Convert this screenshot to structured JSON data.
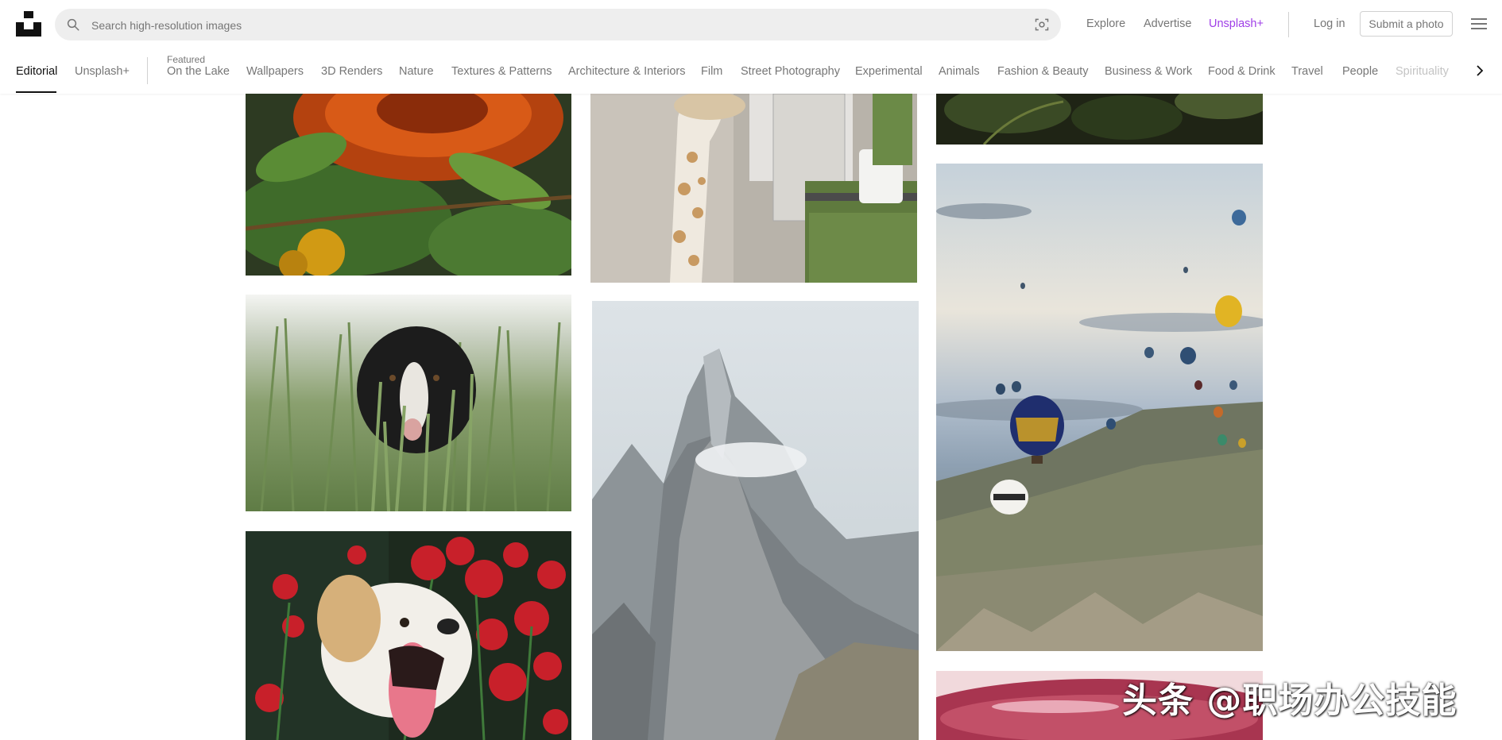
{
  "header": {
    "search": {
      "placeholder": "Search high-resolution images",
      "value": ""
    },
    "nav": {
      "explore": "Explore",
      "advertise": "Advertise",
      "unsplash_plus": "Unsplash+",
      "login": "Log in",
      "submit": "Submit a photo"
    },
    "accent_color": "#9f3ee7"
  },
  "topics": {
    "items": [
      {
        "label": "Editorial",
        "active": true
      },
      {
        "label": "Unsplash+"
      },
      {
        "label": "On the Lake",
        "featured_label": "Featured"
      },
      {
        "label": "Wallpapers"
      },
      {
        "label": "3D Renders"
      },
      {
        "label": "Nature"
      },
      {
        "label": "Textures & Patterns"
      },
      {
        "label": "Architecture & Interiors"
      },
      {
        "label": "Film"
      },
      {
        "label": "Street Photography"
      },
      {
        "label": "Experimental"
      },
      {
        "label": "Animals"
      },
      {
        "label": "Fashion & Beauty"
      },
      {
        "label": "Business & Work"
      },
      {
        "label": "Food & Drink"
      },
      {
        "label": "Travel"
      },
      {
        "label": "People"
      },
      {
        "label": "Spirituality"
      }
    ]
  },
  "icons": {
    "logo": "unsplash-logo",
    "search": "search-icon",
    "visual_search": "visual-search-icon",
    "menu": "hamburger-menu-icon",
    "scroll": "chevron-right-icon"
  },
  "photos": {
    "flower_orange": "orange chrysanthemum with leaves",
    "giraffe_toy": "giraffe toy beside green cabinet",
    "tree_branch": "dark green foliage",
    "dog_in_grass": "black and white dog in tall grass",
    "mountain_peaks": "rocky mountain peaks",
    "hot_air_balloons": "hot air balloons over valley",
    "dog_red_flowers": "white dog yawning among red flowers",
    "red_liquid": "red liquid in glass"
  },
  "watermark": "头条 @职场办公技能"
}
